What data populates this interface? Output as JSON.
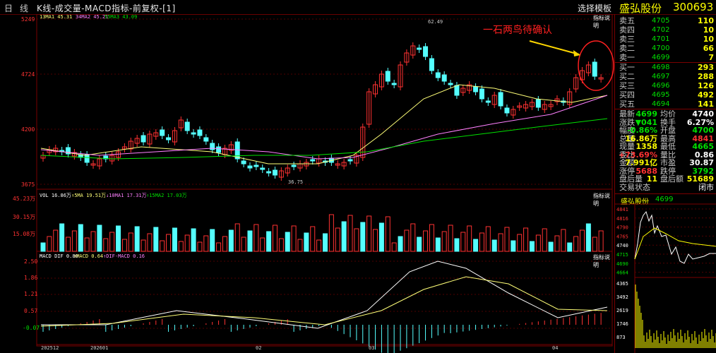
{
  "header": {
    "period_prefix": "日",
    "period_suffix": "线",
    "title": "K线-成交量-MACD指标-前复权-[1]",
    "template_button": "选择模板",
    "stock_name": "盛弘股份",
    "stock_code": "300693"
  },
  "main_chart": {
    "legend": {
      "ma13": "13MA1 45.31",
      "ma34": "34MA2 45.21",
      "ma55": "55MA3 43.09"
    },
    "explain_link": "指标说明",
    "y_labels": [
      "5249",
      "4724",
      "4200",
      "3675"
    ],
    "high_marker": "62.49",
    "low_marker": "36.75",
    "annotation": "一石两鸟待确认",
    "colors": {
      "up": "#ff3232",
      "down": "#54ffff",
      "ma13": "#ffff78",
      "ma34": "#ff80ff",
      "ma55": "#00e000"
    }
  },
  "volume_chart": {
    "legend": {
      "vol": "VOL 16.86万",
      "ma5": "↑5MA 19.51万",
      "ma10": "↓10MA1 17.31万",
      "ma15": "↑15MA2 17.03万"
    },
    "explain_link": "指标说明",
    "y_labels": [
      "45.23万",
      "30.15万",
      "15.08万"
    ]
  },
  "macd_chart": {
    "legend": {
      "dif": "MACD DIF 0.80",
      "dea": "↑MACD 0.64",
      "hist": "↑DIF-MACD 0.16"
    },
    "explain_link": "指标说明",
    "y_labels": [
      "2.50",
      "1.86",
      "1.21",
      "0.57",
      "-0.07"
    ]
  },
  "x_axis": {
    "labels": [
      "202512",
      "202601",
      "02",
      "03",
      "04"
    ]
  },
  "order_book": {
    "sell": [
      {
        "label": "卖五",
        "price": "4705",
        "vol": "110"
      },
      {
        "label": "卖四",
        "price": "4702",
        "vol": "10"
      },
      {
        "label": "卖三",
        "price": "4701",
        "vol": "10"
      },
      {
        "label": "卖二",
        "price": "4700",
        "vol": "66"
      },
      {
        "label": "卖一",
        "price": "4699",
        "vol": "7"
      }
    ],
    "buy": [
      {
        "label": "买一",
        "price": "4698",
        "vol": "293"
      },
      {
        "label": "买二",
        "price": "4697",
        "vol": "288"
      },
      {
        "label": "买三",
        "price": "4696",
        "vol": "126"
      },
      {
        "label": "买四",
        "price": "4695",
        "vol": "492"
      },
      {
        "label": "买五",
        "price": "4694",
        "vol": "141"
      }
    ]
  },
  "stats": [
    {
      "l1": "最新",
      "v1": "4699",
      "c1": "#00e000",
      "l2": "均价",
      "v2": "4740",
      "c2": "#ffffff"
    },
    {
      "l1": "涨跌",
      "v1": "▼041",
      "c1": "#00e000",
      "l2": "换手",
      "v2": "6.27%",
      "c2": "#ffffff"
    },
    {
      "l1": "幅度",
      "v1": "-0.86%",
      "c1": "#00e000",
      "l2": "开盘",
      "v2": "4700",
      "c2": "#00e000"
    },
    {
      "l1": "总量",
      "v1": "16.86万",
      "c1": "#ffff00",
      "l2": "最高",
      "v2": "4841",
      "c2": "#ff3232"
    },
    {
      "l1": "现量",
      "v1": "1358",
      "c1": "#ffff00",
      "l2": "最低",
      "v2": "4665",
      "c2": "#00e000"
    },
    {
      "l1": "委比",
      "v1": "+73.69%",
      "c1": "#ff3232",
      "l2": "量比",
      "v2": "0.86",
      "c2": "#ffffff"
    },
    {
      "l1": "金额",
      "v1": "7.991亿",
      "c1": "#ffff00",
      "l2": "市盈",
      "v2": "30.87",
      "c2": "#ffffff"
    },
    {
      "l1": "涨停",
      "v1": "5688",
      "c1": "#ff3232",
      "l2": "跌停",
      "v2": "3792",
      "c2": "#00e000"
    },
    {
      "l1": "盘后量",
      "v1": "11",
      "c1": "#ffff00",
      "l2": "盘后额",
      "v2": "51689",
      "c2": "#ffff00"
    }
  ],
  "trade_status": {
    "label": "交易状态",
    "value": "闭市"
  },
  "mini_chart": {
    "title": "盛弘股份",
    "price": "4699",
    "price_labels": [
      "4841",
      "4816",
      "4790",
      "4765",
      "4740",
      "4715",
      "4690",
      "4664"
    ],
    "vol_labels": [
      "4365",
      "3492",
      "2619",
      "1746",
      "873"
    ]
  }
}
